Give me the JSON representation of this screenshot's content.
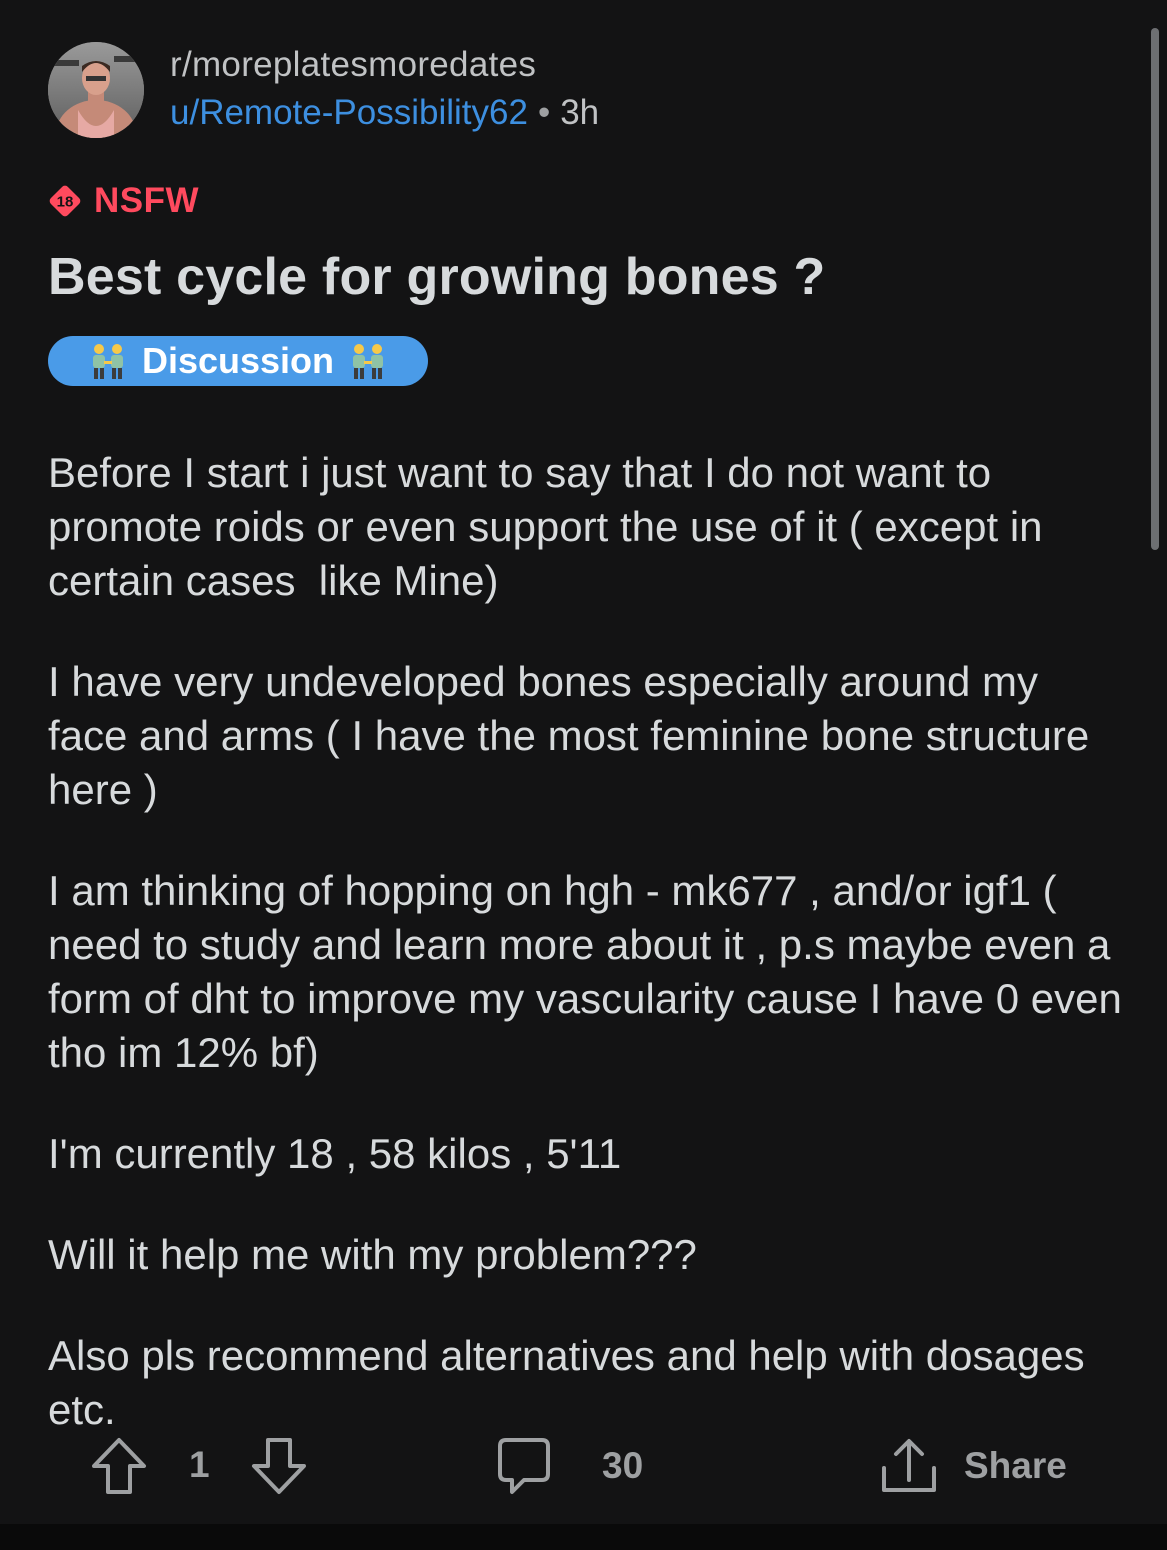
{
  "post": {
    "subreddit": "r/moreplatesmoredates",
    "username": "u/Remote-Possibility62",
    "separator": "•",
    "time": "3h",
    "nsfw_icon_text": "18",
    "nsfw_label": "NSFW",
    "title": "Best cycle for growing bones ?",
    "flair": "Discussion",
    "flair_emoji": "people-holding-hands",
    "paragraphs": [
      "Before I start i just want to say that I do not want to promote roids or even support the use of it ( except in certain cases  like Mine)",
      "I have very undeveloped bones especially around my face and arms ( I have the most feminine bone structure here )",
      "I am thinking of hopping on hgh - mk677 , and/or igf1 ( need to study and learn more about it , p.s maybe even a form of dht to improve my vascularity cause I have 0 even tho im 12% bf)",
      "I'm currently 18 , 58 kilos , 5'11",
      "Will it help me with my problem???",
      "Also pls recommend alternatives and help with dosages etc."
    ]
  },
  "actions": {
    "vote_count": "1",
    "comment_count": "30",
    "share_label": "Share"
  },
  "colors": {
    "background": "#131314",
    "username": "#3d8fe0",
    "nsfw": "#ff4a5e",
    "flair": "#4a9be8"
  }
}
